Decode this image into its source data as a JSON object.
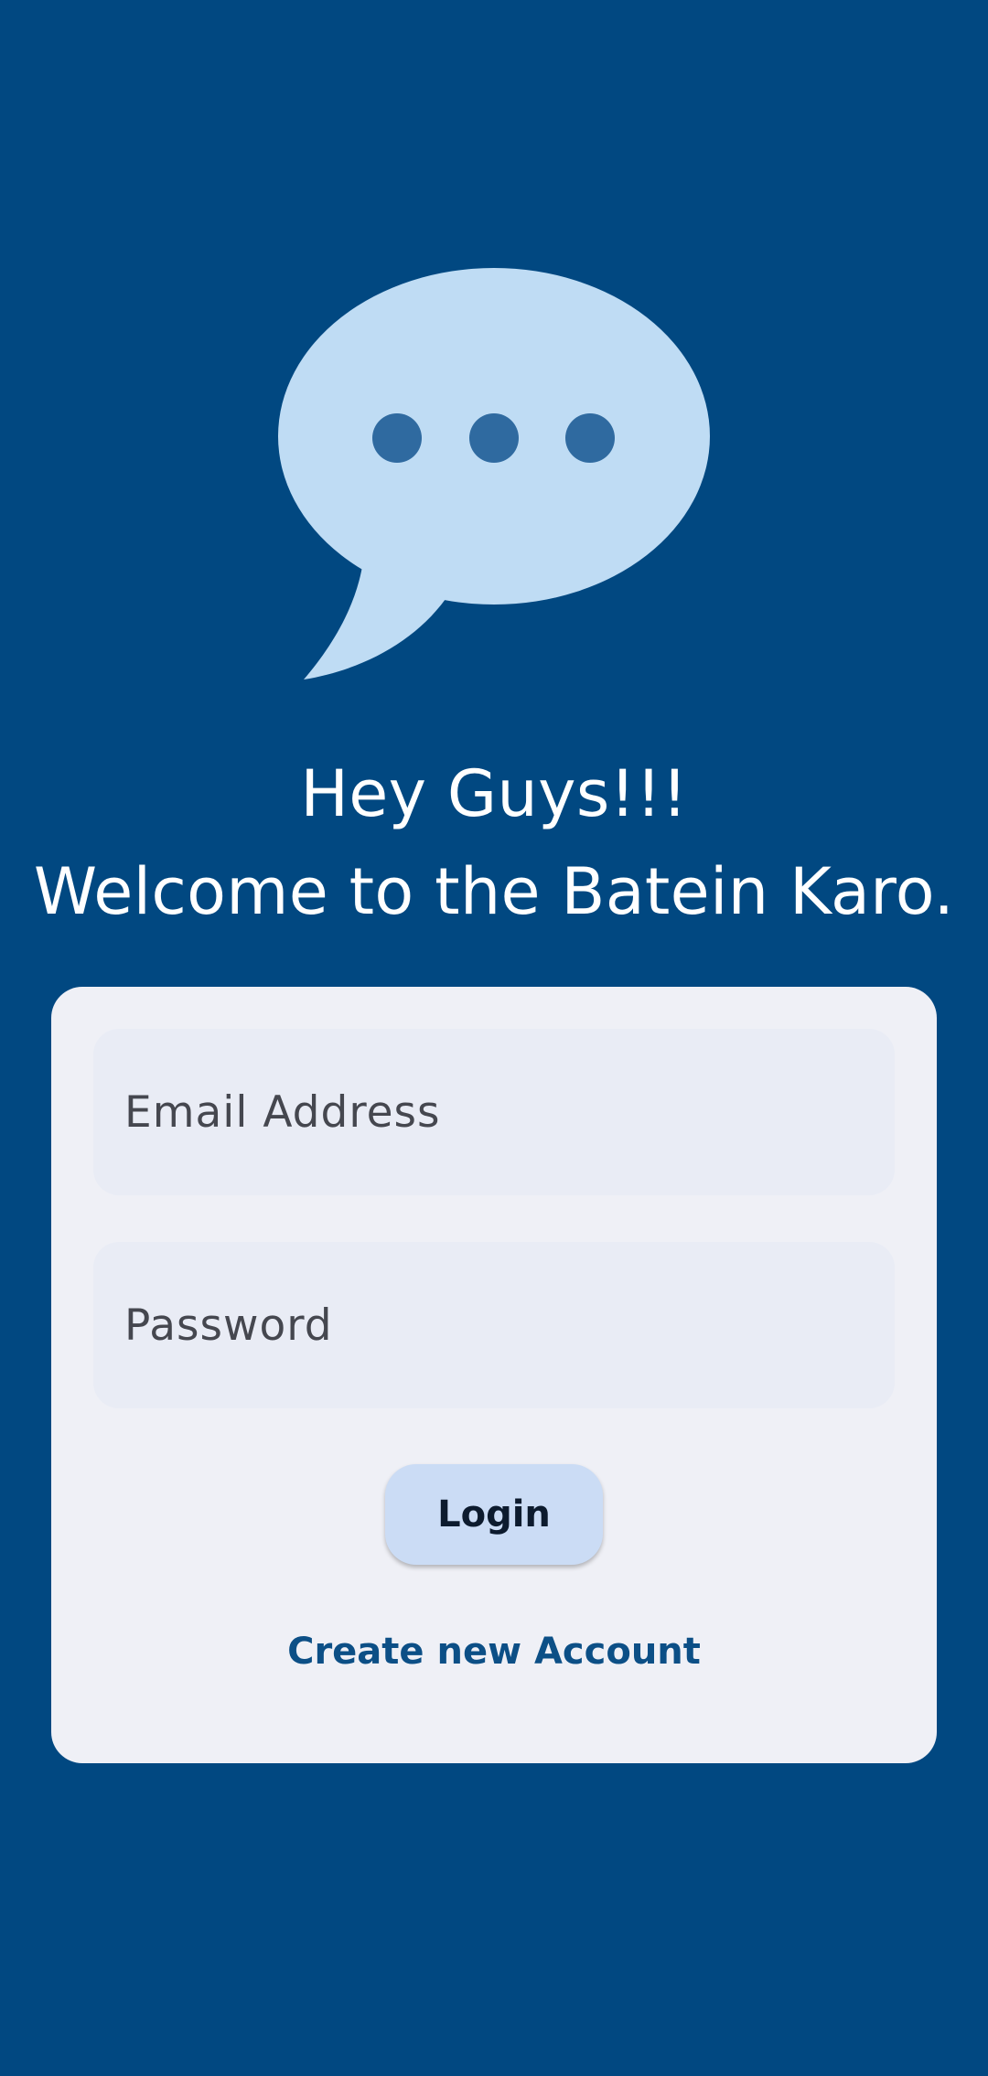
{
  "logo": {
    "icon": "chat-bubble-ellipsis-icon",
    "bubble_color": "#bfdcf4",
    "dot_color": "#2f6aa0"
  },
  "greeting": {
    "line1": "Hey Guys!!!",
    "line2": "Welcome to the Batein Karo."
  },
  "form": {
    "email_placeholder": "Email Address",
    "password_placeholder": "Password",
    "login_label": "Login",
    "create_account_label": "Create new Account"
  },
  "colors": {
    "background": "#014881",
    "card": "#eff0f6",
    "field": "#e9ecf5",
    "button": "#cbdcf5",
    "link": "#0c4f86"
  }
}
